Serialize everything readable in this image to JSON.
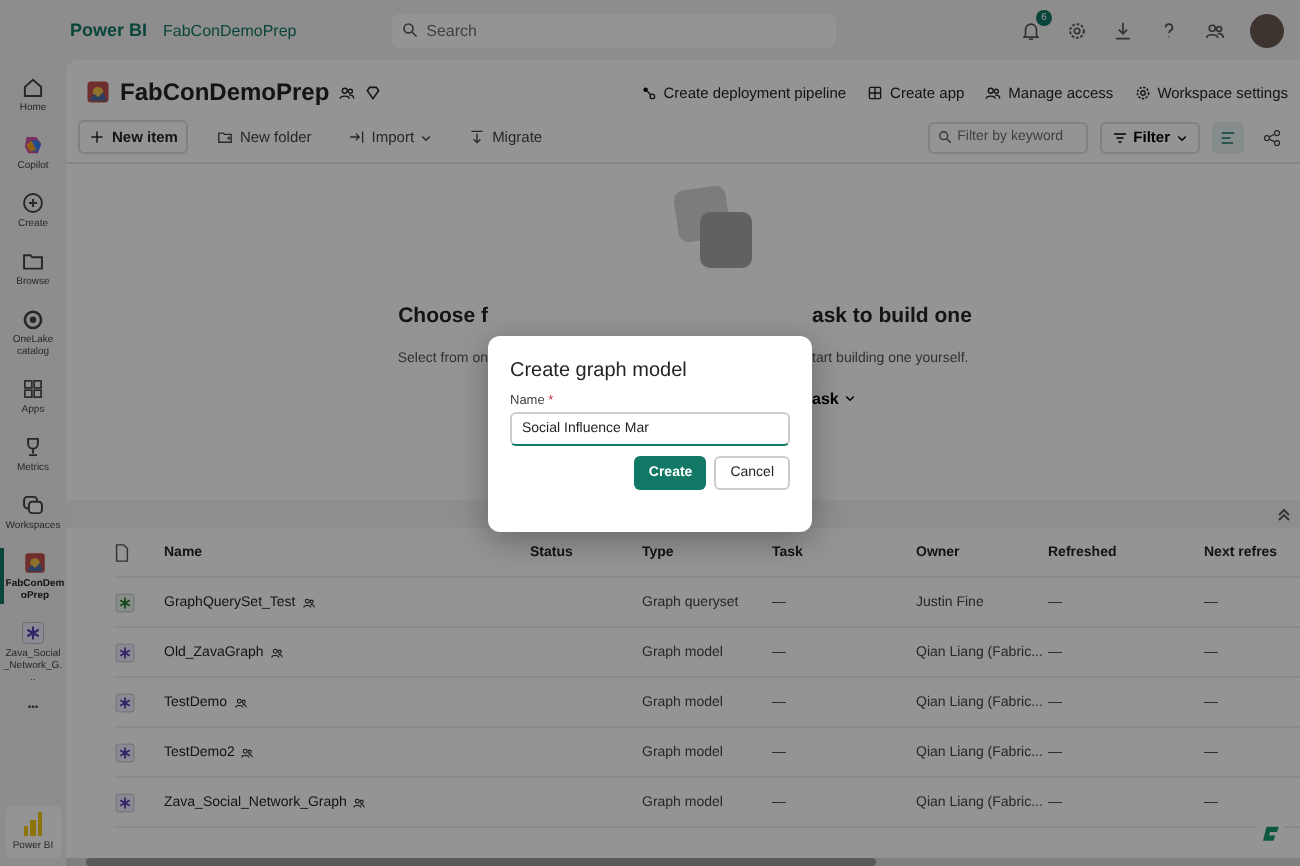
{
  "top_bar": {
    "brand": "Power BI",
    "breadcrumb": "FabConDemoPrep",
    "search": {
      "placeholder": "Search"
    },
    "notification_count": "6"
  },
  "sidebar": {
    "items": [
      {
        "label": "Home",
        "selected": false
      },
      {
        "label": "Copilot",
        "selected": false
      },
      {
        "label": "Create",
        "selected": false
      },
      {
        "label": "Browse",
        "selected": false
      },
      {
        "label": "OneLake catalog",
        "selected": false
      },
      {
        "label": "Apps",
        "selected": false
      },
      {
        "label": "Metrics",
        "selected": false
      },
      {
        "label": "Workspaces",
        "selected": false
      },
      {
        "label": "FabConDemoPrep",
        "selected": true
      },
      {
        "label": "Zava_Social_Network_G...",
        "selected": false
      },
      {
        "label": "•••",
        "selected": false
      }
    ],
    "footer": "Power BI"
  },
  "workspace": {
    "title": "FabConDemoPrep",
    "actions": [
      {
        "label": "Create deployment pipeline"
      },
      {
        "label": "Create app"
      },
      {
        "label": "Manage access"
      },
      {
        "label": "Workspace settings"
      }
    ],
    "toolbar": [
      {
        "label": "New item",
        "caret": false
      },
      {
        "label": "New folder",
        "caret": false
      },
      {
        "label": "Import",
        "caret": true
      },
      {
        "label": "Migrate",
        "caret": false
      }
    ],
    "filter": {
      "placeholder": "Filter by keyword"
    },
    "filter_button": "Filter",
    "views": [
      {
        "selected": true
      },
      {
        "selected": false
      }
    ]
  },
  "empty_state": {
    "heading_left": "Choose f",
    "heading_right": "ask to build one",
    "subtitle_left": "Select from on",
    "subtitle_right": "tart building one yourself.",
    "link_right": "ask"
  },
  "table": {
    "columns": [
      "Name",
      "Status",
      "Type",
      "Task",
      "Owner",
      "Refreshed",
      "Next refres"
    ],
    "rows": [
      {
        "kind": "queryset",
        "name": "GraphQuerySet_Test",
        "type": "Graph queryset",
        "task": "—",
        "owner": "Justin Fine",
        "refreshed": "—",
        "next": "—"
      },
      {
        "kind": "model",
        "name": "Old_ZavaGraph",
        "type": "Graph model",
        "task": "—",
        "owner": "Qian Liang (Fabric...",
        "refreshed": "—",
        "next": "—"
      },
      {
        "kind": "model",
        "name": "TestDemo",
        "type": "Graph model",
        "task": "—",
        "owner": "Qian Liang (Fabric...",
        "refreshed": "—",
        "next": "—"
      },
      {
        "kind": "model",
        "name": "TestDemo2",
        "type": "Graph model",
        "task": "—",
        "owner": "Qian Liang (Fabric...",
        "refreshed": "—",
        "next": "—"
      },
      {
        "kind": "model",
        "name": "Zava_Social_Network_Graph",
        "type": "Graph model",
        "task": "—",
        "owner": "Qian Liang (Fabric...",
        "refreshed": "—",
        "next": "—"
      }
    ]
  },
  "dialog": {
    "title": "Create graph model",
    "field_label": "Name",
    "required_mark": "*",
    "value": "Social Influence Mar",
    "buttons": [
      {
        "label": "Create",
        "kind": "primary"
      },
      {
        "label": "Cancel",
        "kind": "secondary"
      }
    ]
  }
}
